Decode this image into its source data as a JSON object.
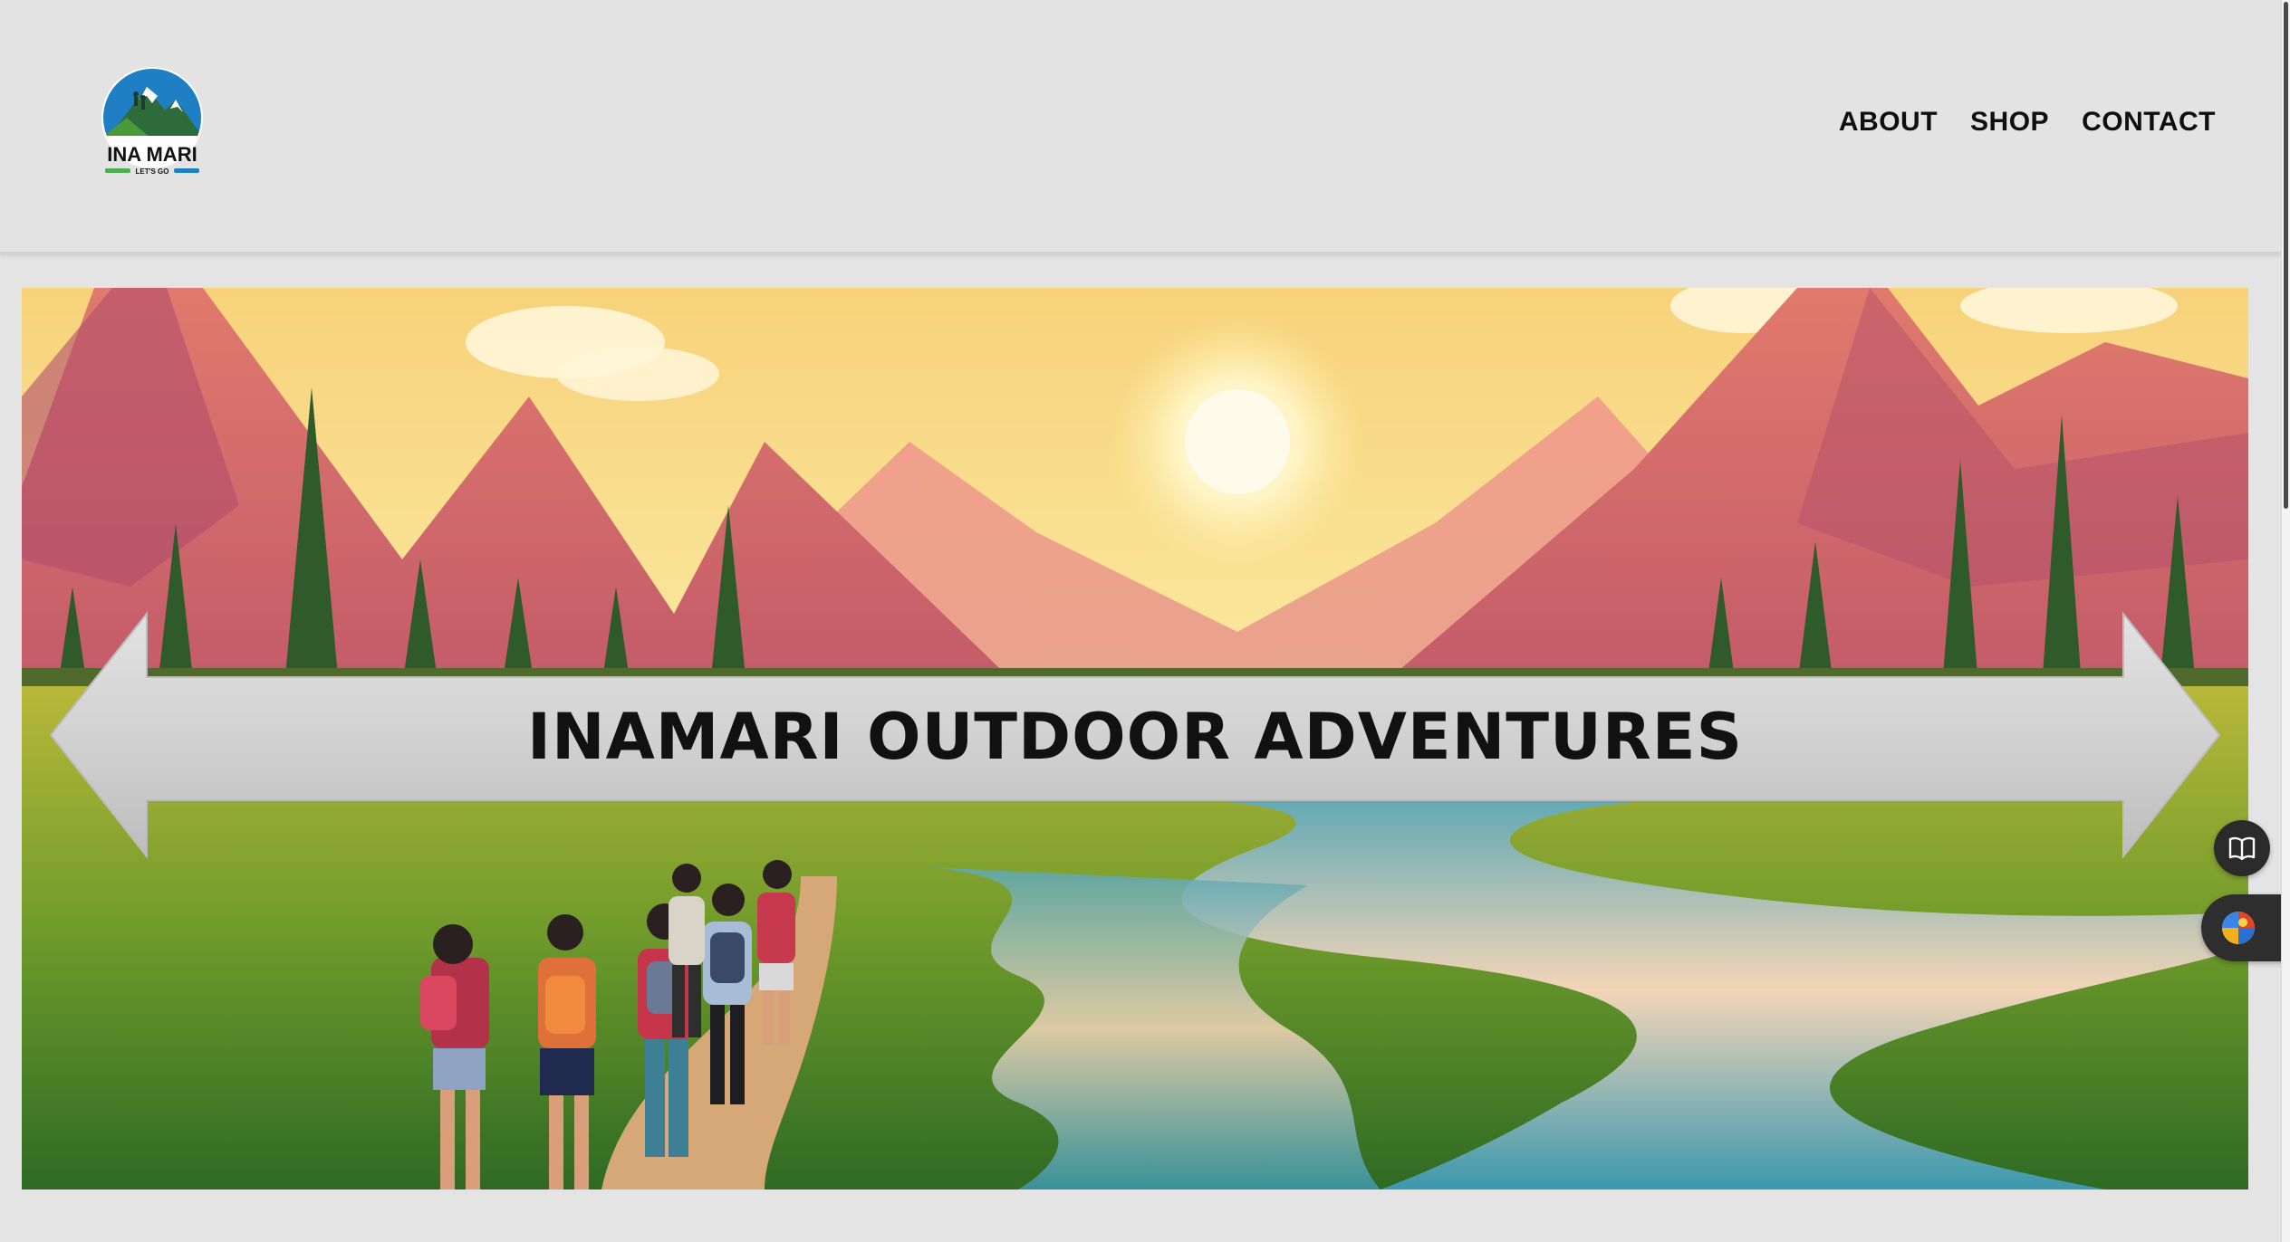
{
  "logo": {
    "name": "INA MARI",
    "tagline": "LET'S GO"
  },
  "nav": {
    "items": [
      {
        "label": "ABOUT"
      },
      {
        "label": "SHOP"
      },
      {
        "label": "CONTACT"
      }
    ]
  },
  "hero": {
    "title": "INAMARI OUTDOOR ADVENTURES",
    "image": "mountain-river-hikers-illustration"
  },
  "widgets": {
    "reader_icon": "open-book-icon",
    "color_icon": "color-wheel-icon"
  },
  "colors": {
    "page_bg": "#e4e4e4",
    "nav_text": "#0f0f0f",
    "banner": "#d3d3d3",
    "sky_top": "#f6dc7e",
    "mountain": "#d8706e",
    "grass": "#6d9a2a",
    "river": "#4fa4b4"
  }
}
